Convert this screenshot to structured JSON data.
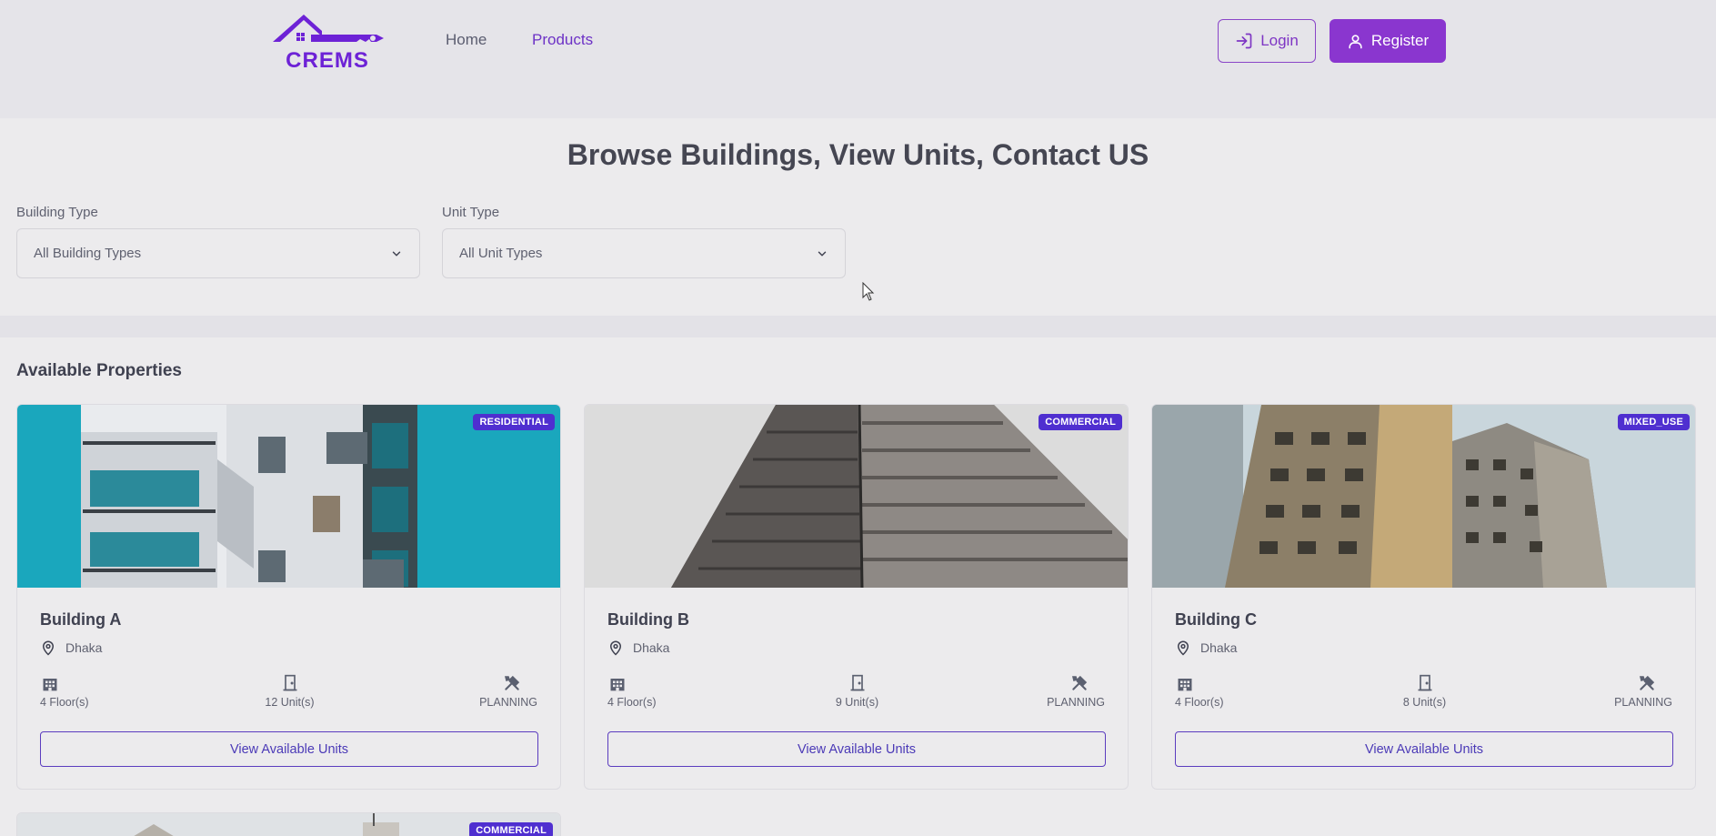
{
  "header": {
    "logo_text": "CREMS",
    "nav": [
      {
        "label": "Home",
        "active": false
      },
      {
        "label": "Products",
        "active": true
      }
    ],
    "login_label": "Login",
    "register_label": "Register"
  },
  "page": {
    "title": "Browse Buildings, View Units, Contact US"
  },
  "filters": {
    "building_type": {
      "label": "Building Type",
      "value": "All Building Types"
    },
    "unit_type": {
      "label": "Unit Type",
      "value": "All Unit Types"
    }
  },
  "properties": {
    "section_title": "Available Properties",
    "items": [
      {
        "name": "Building A",
        "location": "Dhaka",
        "type": "RESIDENTIAL",
        "floors": "4 Floor(s)",
        "units": "12 Unit(s)",
        "status": "PLANNING",
        "button": "View Available Units"
      },
      {
        "name": "Building B",
        "location": "Dhaka",
        "type": "COMMERCIAL",
        "floors": "4 Floor(s)",
        "units": "9 Unit(s)",
        "status": "PLANNING",
        "button": "View Available Units"
      },
      {
        "name": "Building C",
        "location": "Dhaka",
        "type": "MIXED_USE",
        "floors": "4 Floor(s)",
        "units": "8 Unit(s)",
        "status": "PLANNING",
        "button": "View Available Units"
      },
      {
        "type": "COMMERCIAL"
      }
    ]
  },
  "colors": {
    "brand": "#6d32c6",
    "register_bg": "#8a36cf",
    "badge_bg": "#4f2fd0"
  }
}
